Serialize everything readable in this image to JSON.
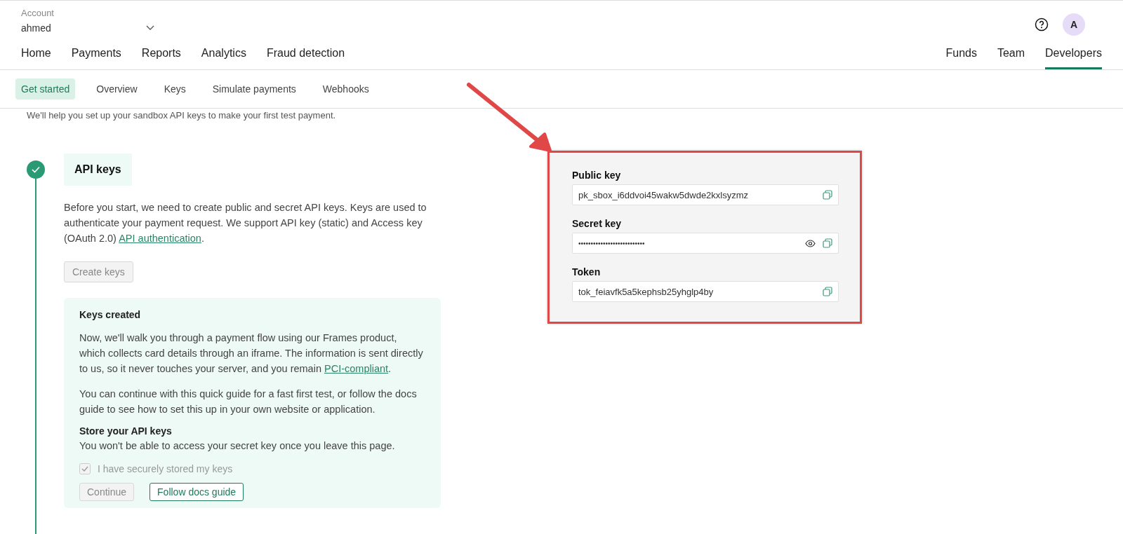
{
  "account": {
    "label": "Account",
    "name": "ahmed"
  },
  "nav_left": [
    {
      "label": "Home",
      "selected": false
    },
    {
      "label": "Payments",
      "selected": false
    },
    {
      "label": "Reports",
      "selected": false
    },
    {
      "label": "Analytics",
      "selected": false
    },
    {
      "label": "Fraud detection",
      "selected": false
    }
  ],
  "nav_right": [
    {
      "label": "Funds",
      "selected": false
    },
    {
      "label": "Team",
      "selected": false
    },
    {
      "label": "Developers",
      "selected": true
    }
  ],
  "avatar": {
    "initial": "A"
  },
  "subnav": [
    {
      "label": "Get started",
      "selected": true
    },
    {
      "label": "Overview",
      "selected": false
    },
    {
      "label": "Keys",
      "selected": false
    },
    {
      "label": "Simulate payments",
      "selected": false
    },
    {
      "label": "Webhooks",
      "selected": false
    }
  ],
  "intro": "We'll help you set up your sandbox API keys to make your first test payment.",
  "step": {
    "title": "API keys",
    "done": true,
    "paragraph": {
      "text": "Before you start, we need to create public and secret API keys. Keys are used to authenticate your payment request. We support API key (static) and Access key (OAuth 2.0) ",
      "link": "API authentication",
      "tail": "."
    },
    "create_button": {
      "label": "Create keys",
      "disabled": true
    },
    "card": {
      "title": "Keys created",
      "paragraph_1": {
        "text": "Now, we'll walk you through a payment flow using our Frames product, which collects card details through an iframe. The information is sent directly to us, so it never touches your server, and you remain ",
        "link": "PCI-compliant",
        "tail": "."
      },
      "paragraph_2": "You can continue with this quick guide for a fast first test, or follow the docs guide to see how to set this up in your own website or application.",
      "store_title": "Store your API keys",
      "store_note": "You won't be able to access your secret key once you leave this page.",
      "checkbox": {
        "label": "I have securely stored my keys",
        "checked": true,
        "disabled": true
      },
      "buttons": [
        {
          "label": "Continue",
          "disabled": true
        },
        {
          "label": "Follow docs guide",
          "disabled": false
        }
      ]
    }
  },
  "keys_panel": {
    "fields": [
      {
        "label": "Public key",
        "value": "pk_sbox_i6ddvoi45wakw5dwde2kxlsyzmz",
        "kind": "plain"
      },
      {
        "label": "Secret key",
        "value": "•••••••••••••••••••••••••••",
        "kind": "secret"
      },
      {
        "label": "Token",
        "value": "tok_feiavfk5a5kephsb25yhglp4by",
        "kind": "plain"
      }
    ]
  }
}
